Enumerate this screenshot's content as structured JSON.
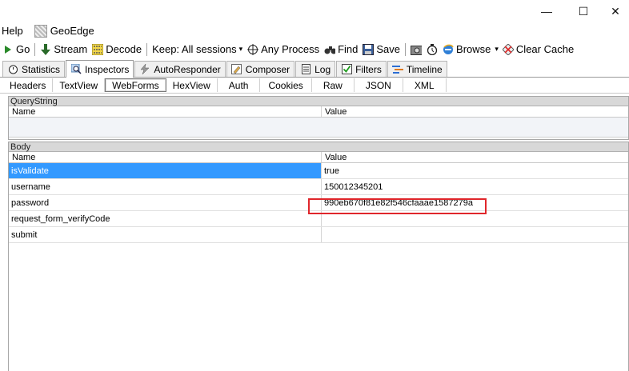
{
  "window": {
    "minimize_glyph": "—",
    "maximize_glyph": "☐",
    "close_glyph": "✕"
  },
  "menu": {
    "help": "Help",
    "geoedge": "GeoEdge"
  },
  "toolbar": {
    "go": "Go",
    "stream": "Stream",
    "decode": "Decode",
    "keep": "Keep: All sessions",
    "any_process": "Any Process",
    "find": "Find",
    "save": "Save",
    "browse": "Browse",
    "clear_cache": "Clear Cache"
  },
  "main_tabs": [
    {
      "label": "Statistics",
      "icon": "stopwatch-icon"
    },
    {
      "label": "Inspectors",
      "icon": "magnifier-icon"
    },
    {
      "label": "AutoResponder",
      "icon": "lightning-icon"
    },
    {
      "label": "Composer",
      "icon": "pencil-icon"
    },
    {
      "label": "Log",
      "icon": "document-icon"
    },
    {
      "label": "Filters",
      "icon": "checkbox-icon"
    },
    {
      "label": "Timeline",
      "icon": "timeline-icon"
    }
  ],
  "sub_tabs": [
    "Headers",
    "TextView",
    "WebForms",
    "HexView",
    "Auth",
    "Cookies",
    "Raw",
    "JSON",
    "XML"
  ],
  "querystring": {
    "title": "QueryString",
    "col_name": "Name",
    "col_value": "Value"
  },
  "body": {
    "title": "Body",
    "col_name": "Name",
    "col_value": "Value",
    "rows": [
      {
        "name": "isValidate",
        "value": "true"
      },
      {
        "name": "username",
        "value": "150012345201"
      },
      {
        "name": "password",
        "value": "990eb670f81e82f546cfaaae1587279a"
      },
      {
        "name": "request_form_verifyCode",
        "value": ""
      },
      {
        "name": "submit",
        "value": ""
      }
    ]
  },
  "colors": {
    "selection": "#3399ff",
    "highlight_box": "#e0262b"
  }
}
